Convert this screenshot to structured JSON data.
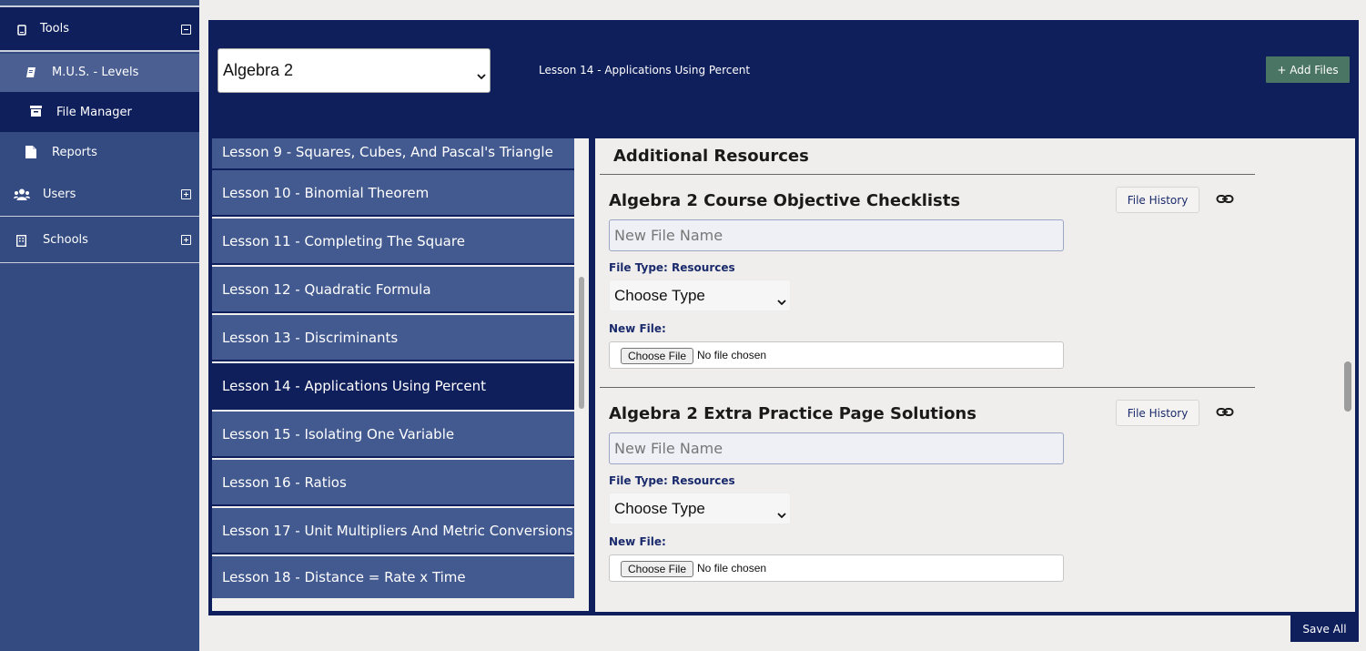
{
  "sidebar": {
    "items": [
      {
        "label": "Tools",
        "icon": "tablet-icon",
        "toggle": "minus"
      },
      {
        "label": "M.U.S. - Levels",
        "icon": "book-icon"
      },
      {
        "label": "File Manager",
        "icon": "archive-icon"
      },
      {
        "label": "Reports",
        "icon": "file-icon"
      },
      {
        "label": "Users",
        "icon": "users-icon",
        "toggle": "plus"
      },
      {
        "label": "Schools",
        "icon": "building-icon",
        "toggle": "plus"
      }
    ]
  },
  "header": {
    "course_select": "Algebra 2",
    "lesson_title": "Lesson 14 - Applications Using Percent",
    "add_files_label": "+ Add Files"
  },
  "lessons": [
    {
      "label": "Lesson 9 - Squares, Cubes, And Pascal's Triangle",
      "active": false
    },
    {
      "label": "Lesson 10 - Binomial Theorem",
      "active": false
    },
    {
      "label": "Lesson 11 - Completing The Square",
      "active": false
    },
    {
      "label": "Lesson 12 - Quadratic Formula",
      "active": false
    },
    {
      "label": "Lesson 13 - Discriminants",
      "active": false
    },
    {
      "label": "Lesson 14 - Applications Using Percent",
      "active": true
    },
    {
      "label": "Lesson 15 - Isolating One Variable",
      "active": false
    },
    {
      "label": "Lesson 16 - Ratios",
      "active": false
    },
    {
      "label": "Lesson 17 - Unit Multipliers And Metric Conversions",
      "active": false
    },
    {
      "label": "Lesson 18 - Distance = Rate x Time",
      "active": false
    }
  ],
  "resources": {
    "heading": "Additional Resources",
    "items": [
      {
        "title": "Algebra 2 Course Objective Checklists",
        "file_history_label": "File History",
        "name_placeholder": "New File Name",
        "file_type_label": "File Type: Resources",
        "type_select": "Choose Type",
        "new_file_label": "New File:",
        "choose_file_label": "Choose File",
        "no_file_label": "No file chosen"
      },
      {
        "title": "Algebra 2 Extra Practice Page Solutions",
        "file_history_label": "File History",
        "name_placeholder": "New File Name",
        "file_type_label": "File Type: Resources",
        "type_select": "Choose Type",
        "new_file_label": "New File:",
        "choose_file_label": "Choose File",
        "no_file_label": "No file chosen"
      }
    ]
  },
  "footer": {
    "save_all_label": "Save All"
  },
  "colors": {
    "navy": "#0f1f5c",
    "sidebar": "#334b80",
    "lesson": "#435a90",
    "add_files": "#4a7463"
  }
}
